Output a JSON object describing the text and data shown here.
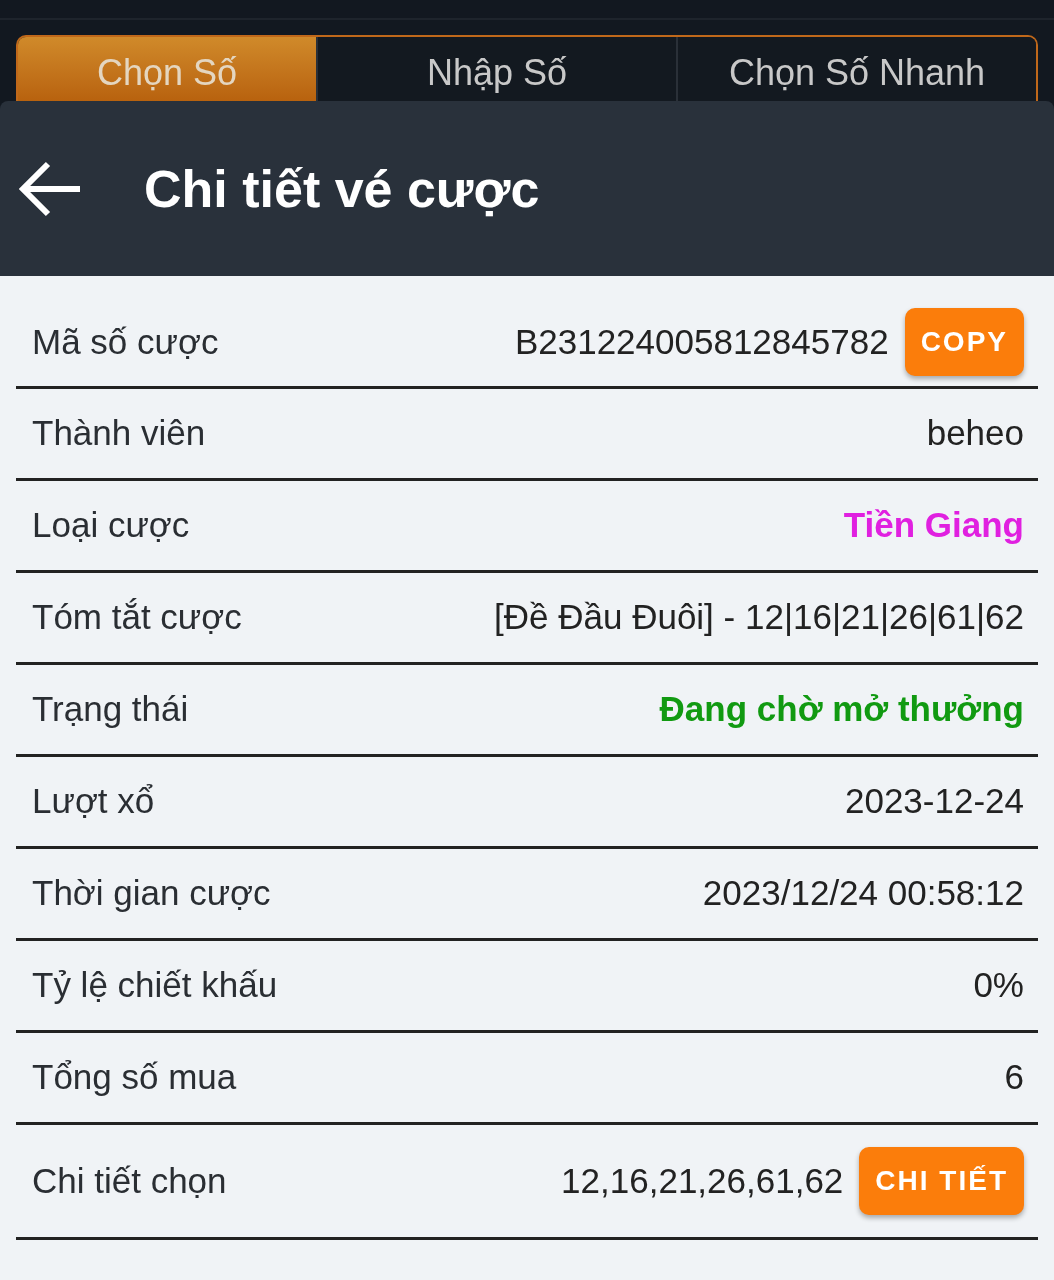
{
  "tabs": [
    {
      "label": "Chọn Số",
      "selected": true
    },
    {
      "label": "Nhập Số",
      "selected": false
    },
    {
      "label": "Chọn Số Nhanh",
      "selected": false
    }
  ],
  "header": {
    "title": "Chi tiết vé cược"
  },
  "rows": [
    {
      "label": "Mã số cược",
      "value": "B231224005812845782",
      "color": "#222222",
      "button": "COPY"
    },
    {
      "label": "Thành viên",
      "value": "beheo",
      "color": "#222222"
    },
    {
      "label": "Loại cược",
      "value": "Tiền Giang",
      "color": "#e020e0"
    },
    {
      "label": "Tóm tắt cược",
      "value": "[Đề Đầu Đuôi] - 12|16|21|26|61|62",
      "color": "#222222"
    },
    {
      "label": "Trạng thái",
      "value": "Đang chờ mở thưởng",
      "color": "#119a11"
    },
    {
      "label": "Lượt xổ",
      "value": "2023-12-24",
      "color": "#222222"
    },
    {
      "label": "Thời gian cược",
      "value": "2023/12/24 00:58:12",
      "color": "#222222"
    },
    {
      "label": "Tỷ lệ chiết khấu",
      "value": "0%",
      "color": "#222222"
    },
    {
      "label": "Tổng số mua",
      "value": "6",
      "color": "#222222"
    },
    {
      "label": "Chi tiết chọn",
      "value": "12,16,21,26,61,62",
      "color": "#222222",
      "button": "CHI TIẾT"
    }
  ]
}
